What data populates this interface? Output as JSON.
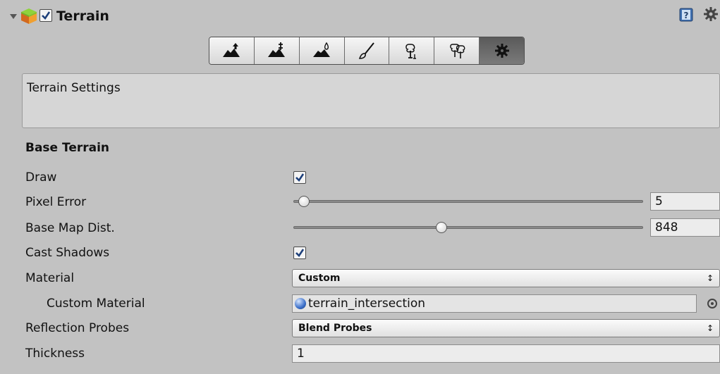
{
  "component": {
    "title": "Terrain",
    "enabled": true,
    "icon": "terrain-cube-icon"
  },
  "header_icons": [
    "help-book-icon",
    "gear-icon"
  ],
  "toolbar": {
    "tools": [
      {
        "name": "raise-lower-terrain-icon",
        "active": false
      },
      {
        "name": "paint-height-icon",
        "active": false
      },
      {
        "name": "smooth-height-icon",
        "active": false
      },
      {
        "name": "paint-texture-icon",
        "active": false
      },
      {
        "name": "place-trees-icon",
        "active": false
      },
      {
        "name": "paint-details-icon",
        "active": false
      },
      {
        "name": "terrain-settings-icon",
        "active": true
      }
    ]
  },
  "helpbox": {
    "text": "Terrain Settings"
  },
  "section": {
    "title": "Base Terrain"
  },
  "fields": {
    "draw": {
      "label": "Draw",
      "checked": true
    },
    "pixel_error": {
      "label": "Pixel Error",
      "value": "5",
      "slider_fraction": 0.05
    },
    "base_map_dist": {
      "label": "Base Map Dist.",
      "value": "848",
      "slider_fraction": 0.42
    },
    "cast_shadows": {
      "label": "Cast Shadows",
      "checked": true
    },
    "material": {
      "label": "Material",
      "value": "Custom"
    },
    "custom_material": {
      "label": "Custom Material",
      "value": "terrain_intersection"
    },
    "reflection_probes": {
      "label": "Reflection Probes",
      "value": "Blend Probes"
    },
    "thickness": {
      "label": "Thickness",
      "value": "1"
    }
  },
  "colors": {
    "background": "#c2c2c2",
    "active_tool": "#5a5a5a",
    "check_mark": "#1d3f7a"
  }
}
